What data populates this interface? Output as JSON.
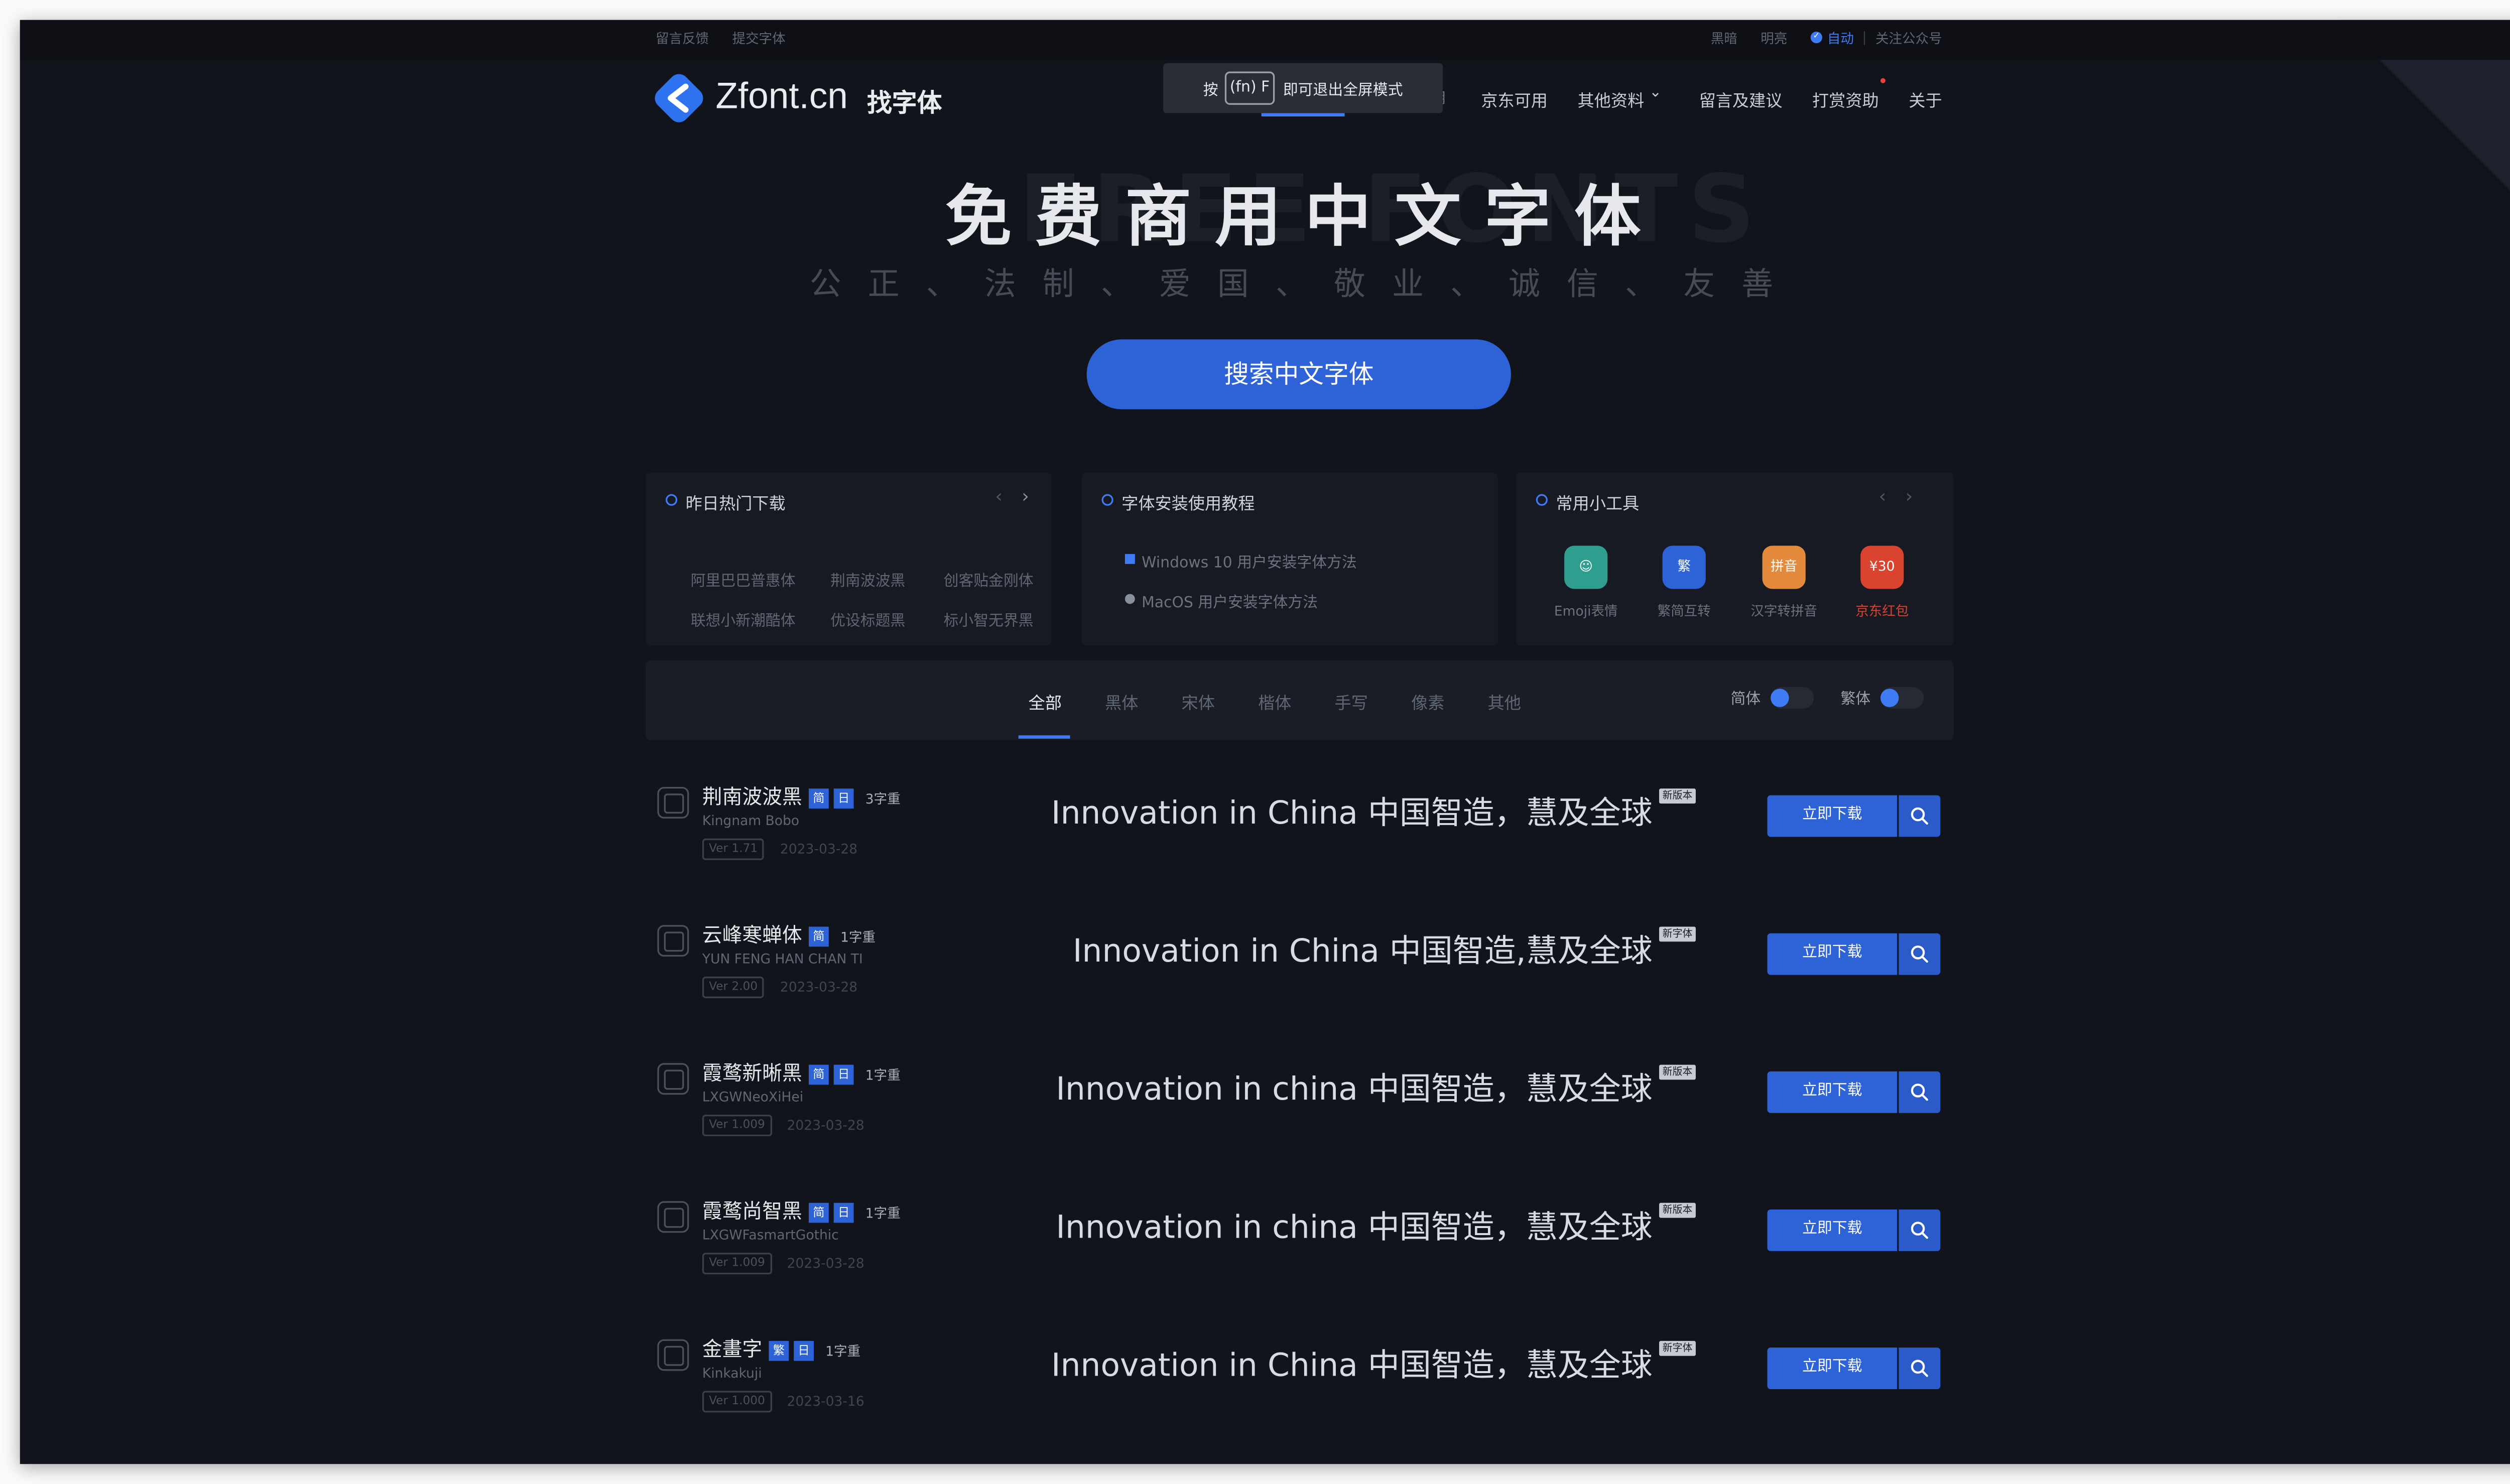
{
  "topbar": {
    "feedback": "留言反馈",
    "submit_font": "提交字体",
    "theme_dark": "黑暗",
    "theme_light": "明亮",
    "theme_auto": "自动",
    "follow": "关注公众号"
  },
  "logo": {
    "name": "Zfont.cn",
    "sub": "找字体"
  },
  "toast": {
    "before": "按",
    "key": "(fn) F",
    "after": "即可退出全屏模式"
  },
  "nav": {
    "hidden": "用",
    "items": [
      "京东可用",
      "其他资料",
      "留言及建议",
      "打赏资助",
      "关于"
    ]
  },
  "hero": {
    "bg": "FREE FONTS",
    "title": "免费商用中文字体",
    "subtitle": "公正、法制、爱国、敬业、诚信、友善",
    "button": "搜索中文字体"
  },
  "hot": {
    "title": "昨日热门下载",
    "items": [
      "阿里巴巴普惠体",
      "荆南波波黑",
      "创客贴金刚体",
      "联想小新潮酷体",
      "优设标题黑",
      "标小智无界黑"
    ]
  },
  "tutorial": {
    "title": "字体安装使用教程",
    "items": [
      "Windows 10 用户安装字体方法",
      "MacOS 用户安装字体方法"
    ]
  },
  "tools": {
    "title": "常用小工具",
    "items": [
      {
        "label": "Emoji表情",
        "glyph": "☺",
        "color": "#2f9e8f"
      },
      {
        "label": "繁简互转",
        "glyph": "繁",
        "color": "#2e63d8"
      },
      {
        "label": "汉字转拼音",
        "glyph": "拼音",
        "color": "#e38a3c"
      },
      {
        "label": "京东红包",
        "glyph": "¥30",
        "color": "#d9432f"
      }
    ]
  },
  "filters": {
    "tabs": [
      "全部",
      "黑体",
      "宋体",
      "楷体",
      "手写",
      "像素",
      "其他"
    ],
    "simplified": "简体",
    "traditional": "繁体"
  },
  "fonts": [
    {
      "name": "荆南波波黑",
      "tags": [
        "简",
        "日"
      ],
      "weight": "3字重",
      "en": "Kingnam Bobo",
      "ver": "Ver 1.71",
      "date": "2023-03-28",
      "preview": "Innovation in China 中国智造，慧及全球",
      "badge": "新版本",
      "download": "立即下载"
    },
    {
      "name": "云峰寒蝉体",
      "tags": [
        "简"
      ],
      "weight": "1字重",
      "en": "YUN FENG HAN CHAN TI",
      "ver": "Ver 2.00",
      "date": "2023-03-28",
      "preview": "Innovation in China 中国智造,慧及全球",
      "badge": "新字体",
      "download": "立即下载"
    },
    {
      "name": "霞鹜新晰黑",
      "tags": [
        "简",
        "日"
      ],
      "weight": "1字重",
      "en": "LXGWNeoXiHei",
      "ver": "Ver 1.009",
      "date": "2023-03-28",
      "preview": "Innovation in china 中国智造，慧及全球",
      "badge": "新版本",
      "download": "立即下载"
    },
    {
      "name": "霞鹜尚智黑",
      "tags": [
        "简",
        "日"
      ],
      "weight": "1字重",
      "en": "LXGWFasmartGothic",
      "ver": "Ver 1.009",
      "date": "2023-03-28",
      "preview": "Innovation in china 中国智造，慧及全球",
      "badge": "新版本",
      "download": "立即下载"
    },
    {
      "name": "金畫字",
      "tags": [
        "繁",
        "日"
      ],
      "weight": "1字重",
      "en": "Kinkakuji",
      "ver": "Ver 1.000",
      "date": "2023-03-16",
      "preview": "Innovation in China 中国智造，慧及全球",
      "badge": "新字体",
      "download": "立即下载"
    }
  ]
}
